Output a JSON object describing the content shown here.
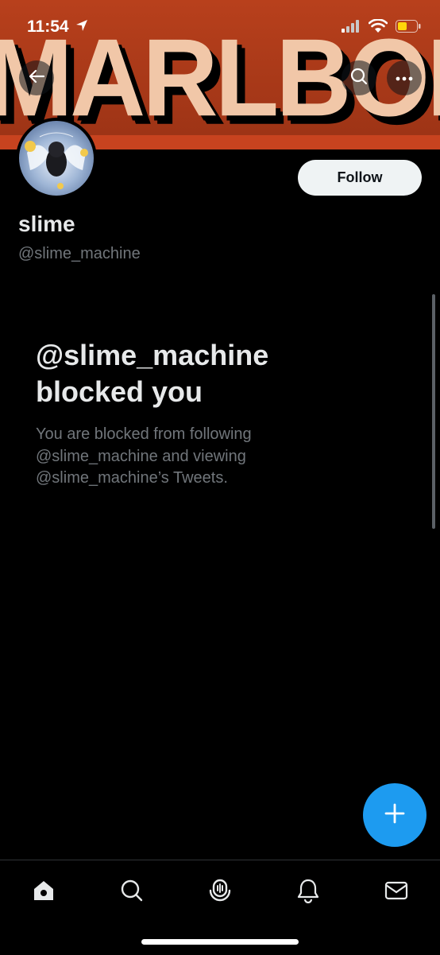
{
  "status_bar": {
    "time": "11:54"
  },
  "banner": {
    "logo_text": "MARLBORO",
    "background_color": "#b8401c"
  },
  "profile": {
    "follow_label": "Follow",
    "display_name": "slime",
    "handle": "@slime_machine"
  },
  "blocked_notice": {
    "title": "@slime_machine blocked you",
    "description": "You are blocked from following @slime_machine and viewing @slime_machine’s Tweets."
  },
  "tab_bar": {
    "items": [
      "home-icon",
      "search-icon",
      "spaces-icon",
      "notifications-icon",
      "messages-icon"
    ]
  },
  "colors": {
    "accent": "#1d9bf0",
    "background": "#000000",
    "secondary_text": "#71767b"
  }
}
